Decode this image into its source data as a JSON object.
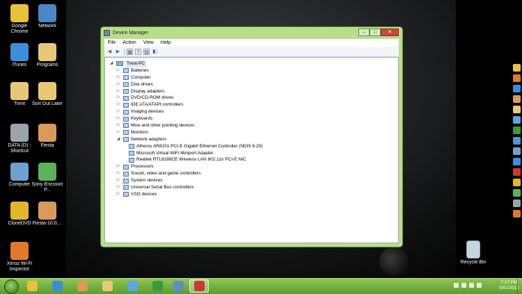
{
  "desktop": {
    "icons_left": [
      {
        "label": "Google Chrome",
        "icon": "chrome-icon",
        "color": "#e8c23a"
      },
      {
        "label": "Network",
        "icon": "network-icon",
        "color": "#4a86c8"
      },
      {
        "label": "iTunes",
        "icon": "itunes-icon",
        "color": "#3a8edb"
      },
      {
        "label": "Programs",
        "icon": "folder-icon",
        "color": "#e7c877"
      },
      {
        "label": "Trent",
        "icon": "folder-icon",
        "color": "#e7c877"
      },
      {
        "label": "Sort Out Later",
        "icon": "folder-icon",
        "color": "#e7c877"
      },
      {
        "label": "DATA (D) - Shortcut",
        "icon": "drive-icon",
        "color": "#9aa4ad"
      },
      {
        "label": "Fiesta",
        "icon": "game-icon",
        "color": "#d99a5a"
      },
      {
        "label": "Computer",
        "icon": "computer-icon",
        "color": "#6fa0d0"
      },
      {
        "label": "Sony Ericsson P...",
        "icon": "phone-icon",
        "color": "#5bb35b"
      },
      {
        "label": "CloneDVD",
        "icon": "dvd-icon",
        "color": "#e2b52b"
      },
      {
        "label": "Fiesta-10.0....",
        "icon": "game-icon",
        "color": "#d99a5a"
      },
      {
        "label": "Xirrus Wi-Fi Inspector",
        "icon": "wifi-icon",
        "color": "#e07a2a"
      }
    ],
    "recycle_bin": {
      "label": "Recycle Bin",
      "icon": "recycle-bin-icon"
    }
  },
  "window": {
    "title": "Device Manager",
    "controls": {
      "minimize": "–",
      "maximize": "□",
      "close": "✕"
    },
    "menu": [
      "File",
      "Action",
      "View",
      "Help"
    ],
    "toolbar": [
      "back-icon",
      "forward-icon",
      "properties-icon",
      "help-icon",
      "show-hidden-icon",
      "scan-hardware-icon"
    ],
    "tree": {
      "root": "Trent-PC",
      "categories": [
        {
          "label": "Batteries",
          "expander": "▷"
        },
        {
          "label": "Computer",
          "expander": "▷"
        },
        {
          "label": "Disk drives",
          "expander": "▷"
        },
        {
          "label": "Display adapters",
          "expander": "▷"
        },
        {
          "label": "DVD/CD-ROM drives",
          "expander": "▷"
        },
        {
          "label": "IDE ATA/ATAPI controllers",
          "expander": "▷"
        },
        {
          "label": "Imaging devices",
          "expander": "▷"
        },
        {
          "label": "Keyboards",
          "expander": "▷"
        },
        {
          "label": "Mice and other pointing devices",
          "expander": "▷"
        },
        {
          "label": "Monitors",
          "expander": "▷"
        },
        {
          "label": "Network adapters",
          "expander": "◢"
        }
      ],
      "network_adapters": [
        "Atheros AR8151 PCI-E Gigabit Ethernet Controller (NDIS 6.20)",
        "Microsoft Virtual WiFi Miniport Adapter",
        "Realtek RTL8188CE Wireless LAN 802.11n PCI-E NIC"
      ],
      "categories_after": [
        {
          "label": "Processors",
          "expander": "▷"
        },
        {
          "label": "Sound, video and game controllers",
          "expander": "▷"
        },
        {
          "label": "System devices",
          "expander": "▷"
        },
        {
          "label": "Universal Serial Bus controllers",
          "expander": "▷"
        },
        {
          "label": "VSO devices",
          "expander": "▷"
        }
      ]
    }
  },
  "taskbar": {
    "items": [
      {
        "icon": "chrome-icon",
        "color": "#e8c23a",
        "active": false
      },
      {
        "icon": "itunes-icon",
        "color": "#3a8edb",
        "active": false
      },
      {
        "icon": "fiesta-icon",
        "color": "#d99a5a",
        "active": false
      },
      {
        "icon": "explorer-icon",
        "color": "#e7c877",
        "active": false
      },
      {
        "icon": "messenger-icon",
        "color": "#59a6e0",
        "active": false
      },
      {
        "icon": "utorrent-icon",
        "color": "#3c9a3c",
        "active": false
      },
      {
        "icon": "remote-desktop-icon",
        "color": "#5b8fc7",
        "active": false
      },
      {
        "icon": "device-manager-icon",
        "color": "#c83a32",
        "active": true
      }
    ],
    "time": "7:27 PM",
    "date": "5/01/2012"
  },
  "colors": {
    "window_frame": "#b9de8a",
    "taskbar": "#6fae3a"
  }
}
